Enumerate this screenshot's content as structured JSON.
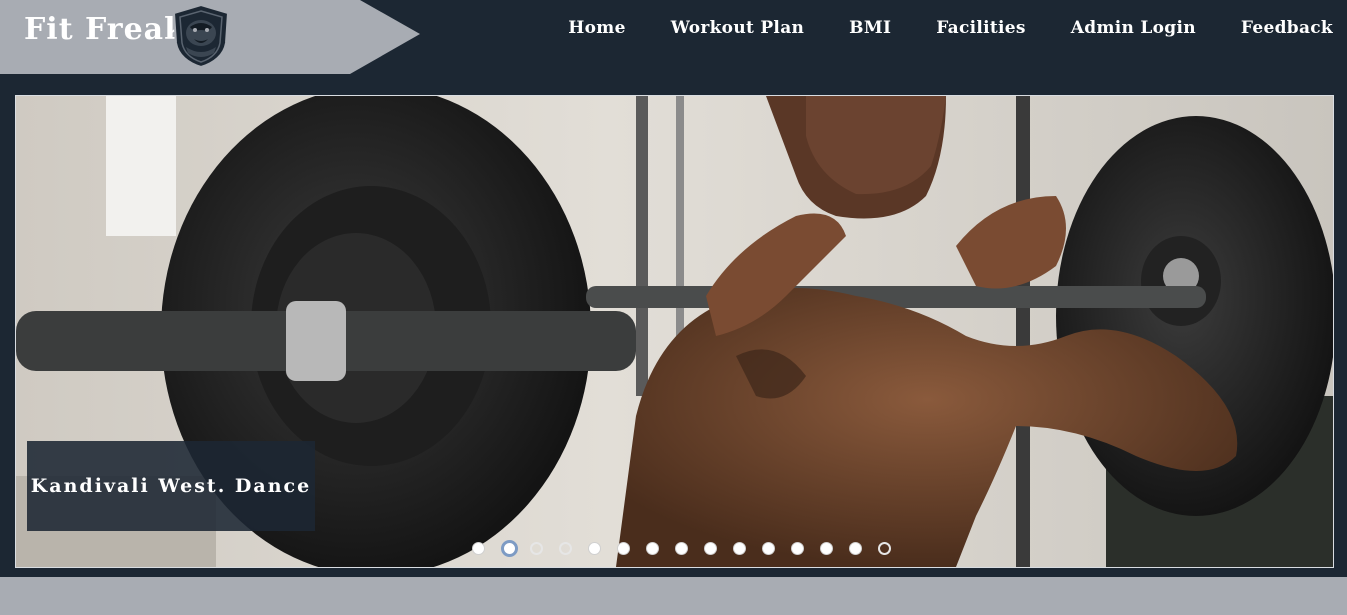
{
  "brand": {
    "title": "Fit Freak",
    "logo_icon": "gorilla-shield-logo-icon",
    "banner_color": "#a8acb3"
  },
  "nav": {
    "items": [
      {
        "label": "Home"
      },
      {
        "label": "Workout Plan"
      },
      {
        "label": "BMI"
      },
      {
        "label": "Facilities"
      },
      {
        "label": "Admin Login"
      },
      {
        "label": "Feedback"
      }
    ]
  },
  "slider": {
    "image_icon": "weightlifter-barbell-photo",
    "caption": "Kandivali West. Dance",
    "slide_count": 15,
    "active_index": 1,
    "hollow_indices": [
      2,
      3,
      14
    ]
  },
  "colors": {
    "background": "#1c2733",
    "footer_strip": "#a8acb3",
    "active_dot_ring": "#7d9bc4"
  }
}
